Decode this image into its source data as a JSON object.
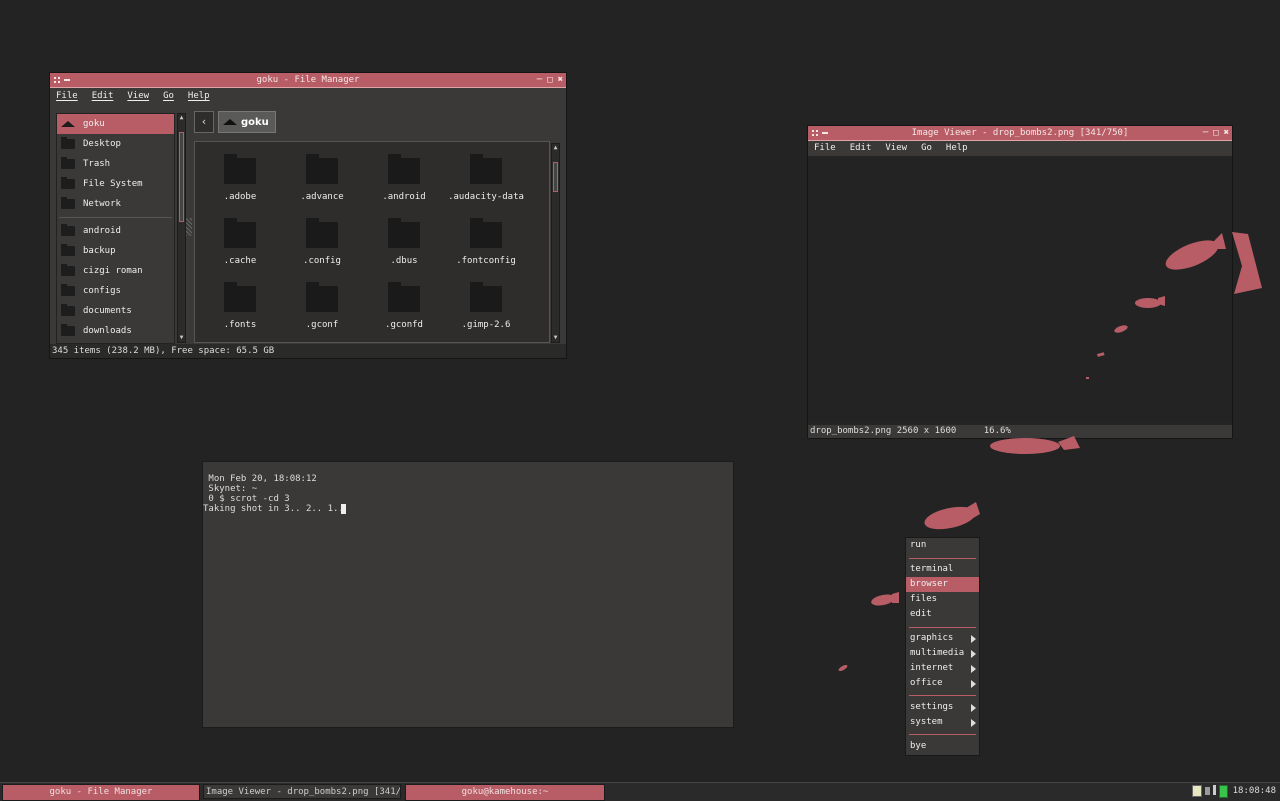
{
  "colors": {
    "accent": "#b85d66",
    "background": "#232323",
    "panel": "#3a3937"
  },
  "file_manager": {
    "title": "goku - File Manager",
    "menu": [
      "File",
      "Edit",
      "View",
      "Go",
      "Help"
    ],
    "places": [
      {
        "label": "goku",
        "icon": "home-icon"
      },
      {
        "label": "Desktop",
        "icon": "desktop-icon"
      },
      {
        "label": "Trash",
        "icon": "trash-icon"
      },
      {
        "label": "File System",
        "icon": "drive-icon"
      },
      {
        "label": "Network",
        "icon": "network-icon"
      }
    ],
    "bookmarks": [
      "android",
      "backup",
      "cizgi roman",
      "configs",
      "documents",
      "downloads"
    ],
    "breadcrumb": "goku",
    "files": [
      ".adobe",
      ".advance",
      ".android",
      ".audacity-data",
      ".cache",
      ".config",
      ".dbus",
      ".fontconfig",
      ".fonts",
      ".gconf",
      ".gconfd",
      ".gimp-2.6"
    ],
    "status": "345 items (238.2 MB), Free space: 65.5 GB"
  },
  "image_viewer": {
    "title": "Image Viewer - drop_bombs2.png [341/750]",
    "menu": [
      "File",
      "Edit",
      "View",
      "Go",
      "Help"
    ],
    "status_file": "drop_bombs2.png 2560 x 1600",
    "zoom": "16.6%"
  },
  "terminal": {
    "lines": [
      " Mon Feb 20, 18:08:12",
      " Skynet: ~",
      " 0 $ scrot -cd 3",
      "Taking shot in 3.. 2.. 1.."
    ]
  },
  "menu": {
    "top": [
      "run"
    ],
    "apps": [
      "terminal",
      "browser",
      "files",
      "edit"
    ],
    "selected": "browser",
    "categories": [
      "graphics",
      "multimedia",
      "internet",
      "office"
    ],
    "system": [
      "settings",
      "system"
    ],
    "bottom": [
      "bye"
    ]
  },
  "taskbar": {
    "tasks": [
      "goku - File Manager",
      "Image Viewer - drop_bombs2.png [341/...",
      "goku@kamehouse:~"
    ],
    "clock": "18:08:48"
  }
}
